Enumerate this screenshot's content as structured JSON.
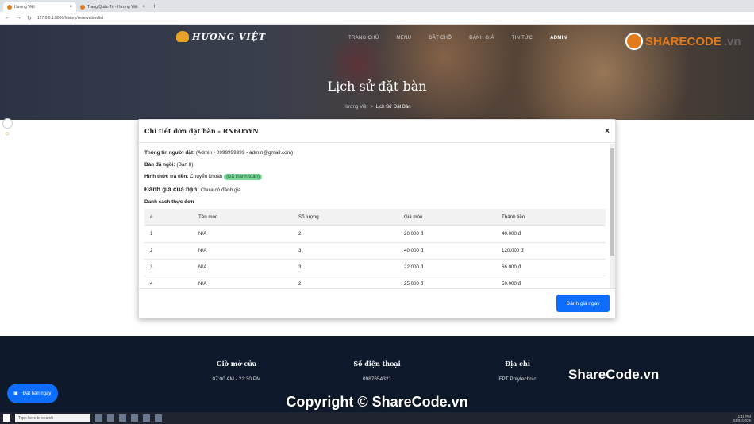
{
  "browser": {
    "tabs": [
      {
        "title": "Hương Việt",
        "active": true
      },
      {
        "title": "Trang Quản Trị - Hương Việt",
        "active": false
      }
    ],
    "new_tab": "+",
    "url": "127.0.0.1:8000/history/reservation/list"
  },
  "site": {
    "logo_text": "HƯƠNG VIỆT",
    "nav": [
      "TRANG CHỦ",
      "MENU",
      "ĐẶT CHỖ",
      "ĐÁNH GIÁ",
      "TIN TỨC",
      "ADMIN"
    ],
    "page_title": "Lịch sử đặt bàn",
    "breadcrumb": {
      "home": "Hương Việt",
      "sep": ">",
      "current": "Lịch Sử Đặt Bàn"
    }
  },
  "modal": {
    "title": "Chi tiết đơn đặt bàn - RN6O5YN",
    "close": "×",
    "info_label": "Thông tin người đặt:",
    "info_value": "(Admin - 0999999999 - admin@gmail.com)",
    "table_label": "Bàn đã ngồi:",
    "table_value": "(Bàn 8)",
    "payment_label": "Hình thức trả tiền:",
    "payment_value": "Chuyển khoản",
    "payment_status": "(Đã thanh toán)",
    "review_label": "Đánh giá của bạn:",
    "review_value": "Chưa có đánh giá",
    "list_label": "Danh sách thực đơn",
    "columns": [
      "#",
      "Tên món",
      "Số lượng",
      "Giá món",
      "Thành tiền"
    ],
    "rows": [
      [
        "1",
        "N/A",
        "2",
        "20.000 đ",
        "40.000 đ"
      ],
      [
        "2",
        "N/A",
        "3",
        "40.000 đ",
        "120.000 đ"
      ],
      [
        "3",
        "N/A",
        "3",
        "22.000 đ",
        "66.000 đ"
      ],
      [
        "4",
        "N/A",
        "2",
        "25.000 đ",
        "50.000 đ"
      ]
    ],
    "rate_button": "Đánh giá ngay"
  },
  "footer": {
    "hours_title": "Giờ mở cửa",
    "hours_value": "07:00 AM - 22:30 PM",
    "phone_title": "Số điện thoại",
    "phone_value": "0987654321",
    "address_title": "Địa chỉ",
    "address_value": "FPT Polytechnic"
  },
  "book_button": "Đặt bàn ngay",
  "watermark": {
    "logo": "SHARECODE",
    "logo_suffix": ".vn",
    "mid": "ShareCode.vn",
    "copyright": "Copyright © ShareCode.vn"
  },
  "taskbar": {
    "search_placeholder": "Type here to search",
    "time": "11:11 PM",
    "date": "04/02/2025"
  },
  "colors": {
    "primary": "#0d6efd",
    "footer_bg": "#0e1a2b",
    "paid_badge": "#7bd89a",
    "accent": "#e37b1c"
  }
}
